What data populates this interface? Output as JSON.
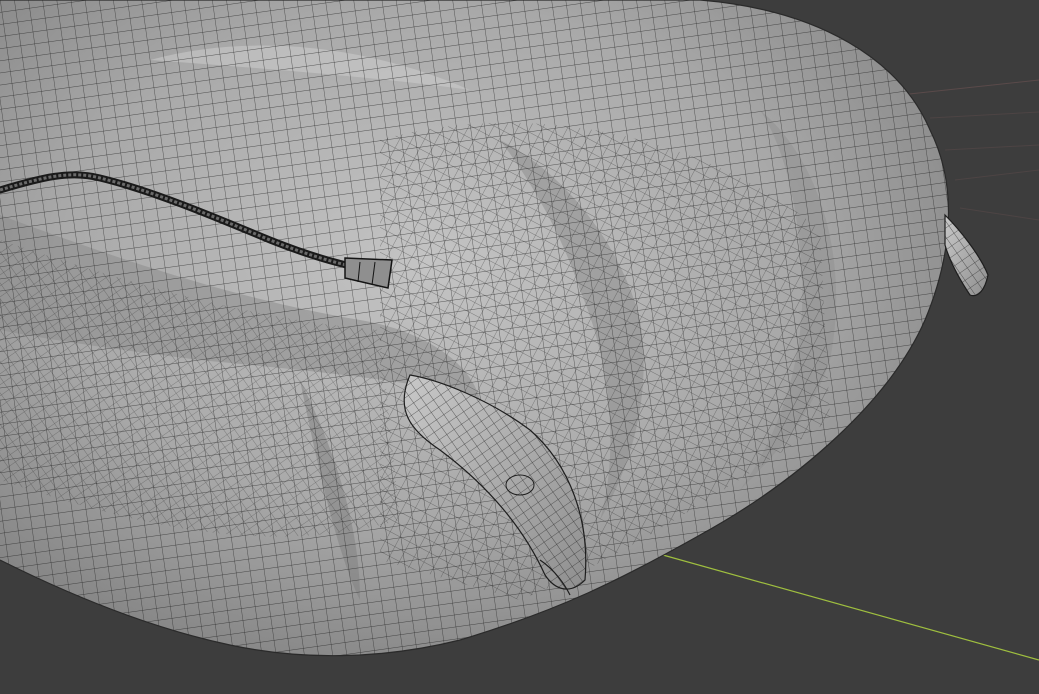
{
  "app": {
    "name": "3D viewport",
    "mode": "wireframe-overlay-on-solid"
  },
  "viewport": {
    "background_color": "#3d3d3d",
    "grid_floor_color": "#383838",
    "x_axis_color": "#9fbf3f",
    "grid_line_color": "#5a4a4a",
    "mesh_fill_color": "#a9a9a9",
    "mesh_highlight_color": "#cfcfcf",
    "mesh_shadow_color": "#6f6f6f",
    "wire_color": "#141414",
    "zipper_color": "#1a1a1a"
  },
  "objects": [
    {
      "name": "backpack-body-mesh",
      "type": "mesh"
    },
    {
      "name": "zipper-track",
      "type": "mesh"
    },
    {
      "name": "zipper-pull",
      "type": "mesh"
    },
    {
      "name": "strap-loop-front",
      "type": "mesh"
    },
    {
      "name": "strap-loop-side",
      "type": "mesh"
    }
  ]
}
